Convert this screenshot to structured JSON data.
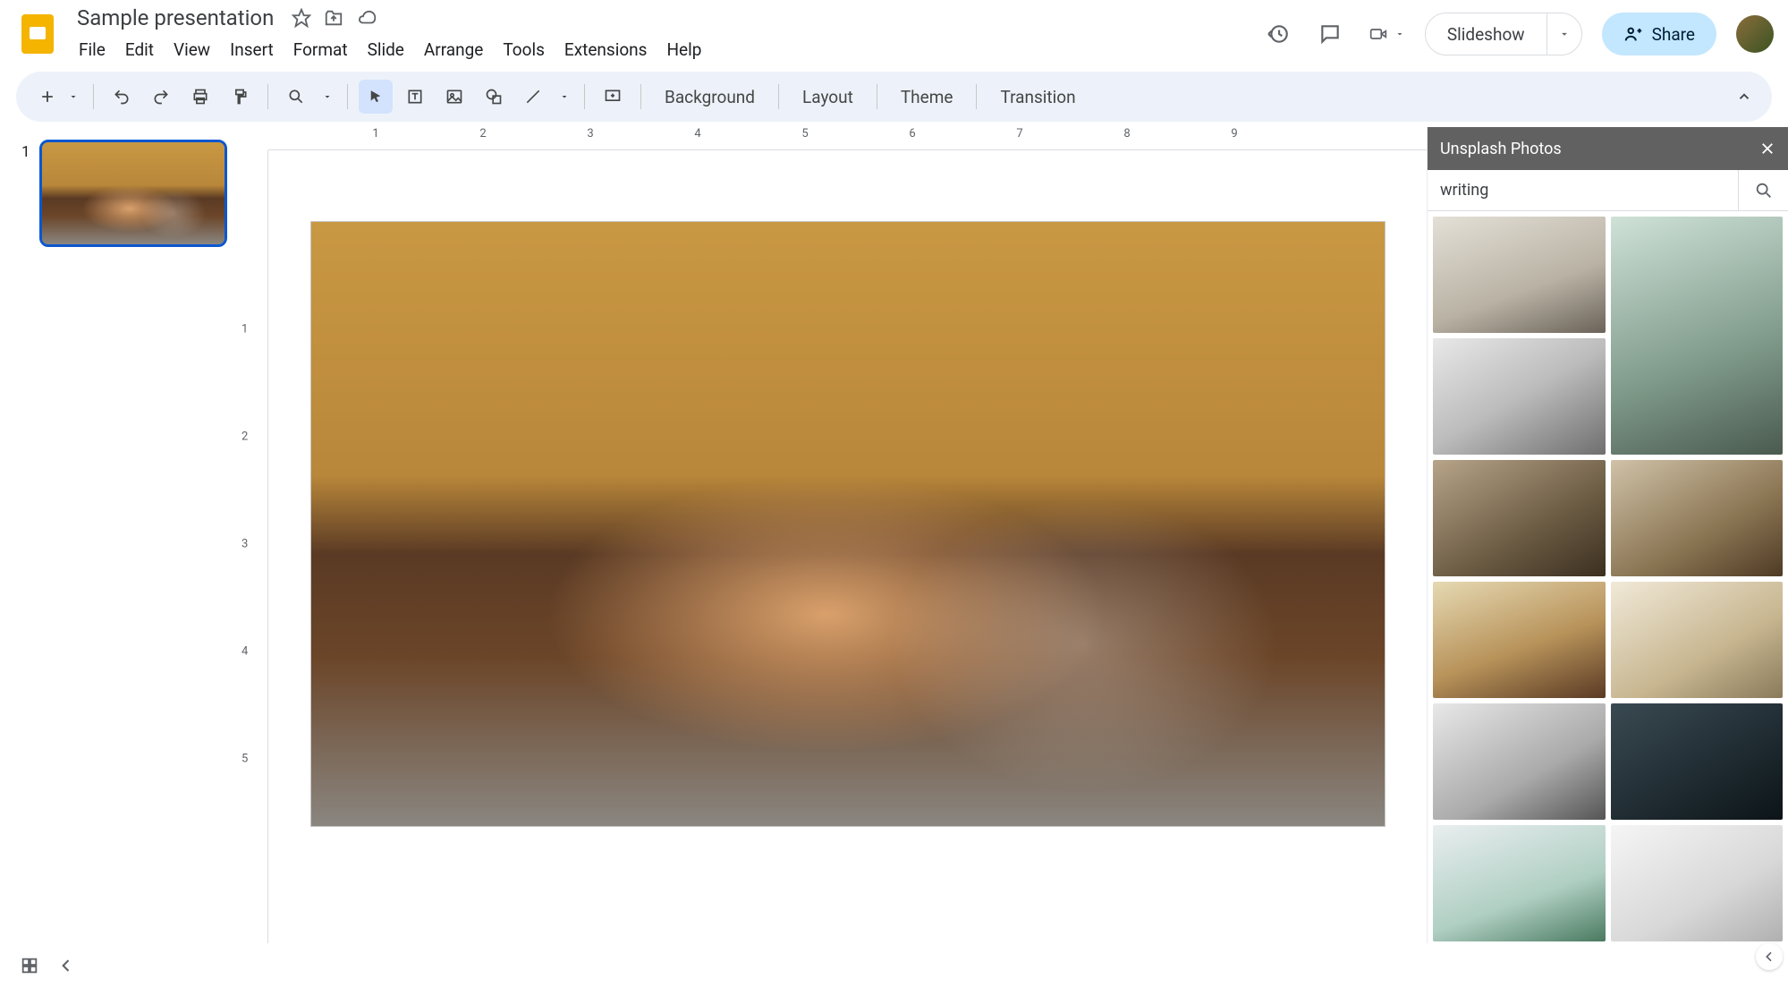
{
  "header": {
    "doc_title": "Sample presentation",
    "menubar": [
      "File",
      "Edit",
      "View",
      "Insert",
      "Format",
      "Slide",
      "Arrange",
      "Tools",
      "Extensions",
      "Help"
    ],
    "slideshow_label": "Slideshow",
    "share_label": "Share"
  },
  "toolbar": {
    "background": "Background",
    "layout": "Layout",
    "theme": "Theme",
    "transition": "Transition"
  },
  "ruler_h": [
    "1",
    "2",
    "3",
    "4",
    "5",
    "6",
    "7",
    "8",
    "9"
  ],
  "ruler_v": [
    "1",
    "2",
    "3",
    "4",
    "5"
  ],
  "filmstrip": {
    "slides": [
      {
        "num": "1"
      }
    ]
  },
  "sidepanel": {
    "title": "Unsplash Photos",
    "search_value": "writing"
  }
}
